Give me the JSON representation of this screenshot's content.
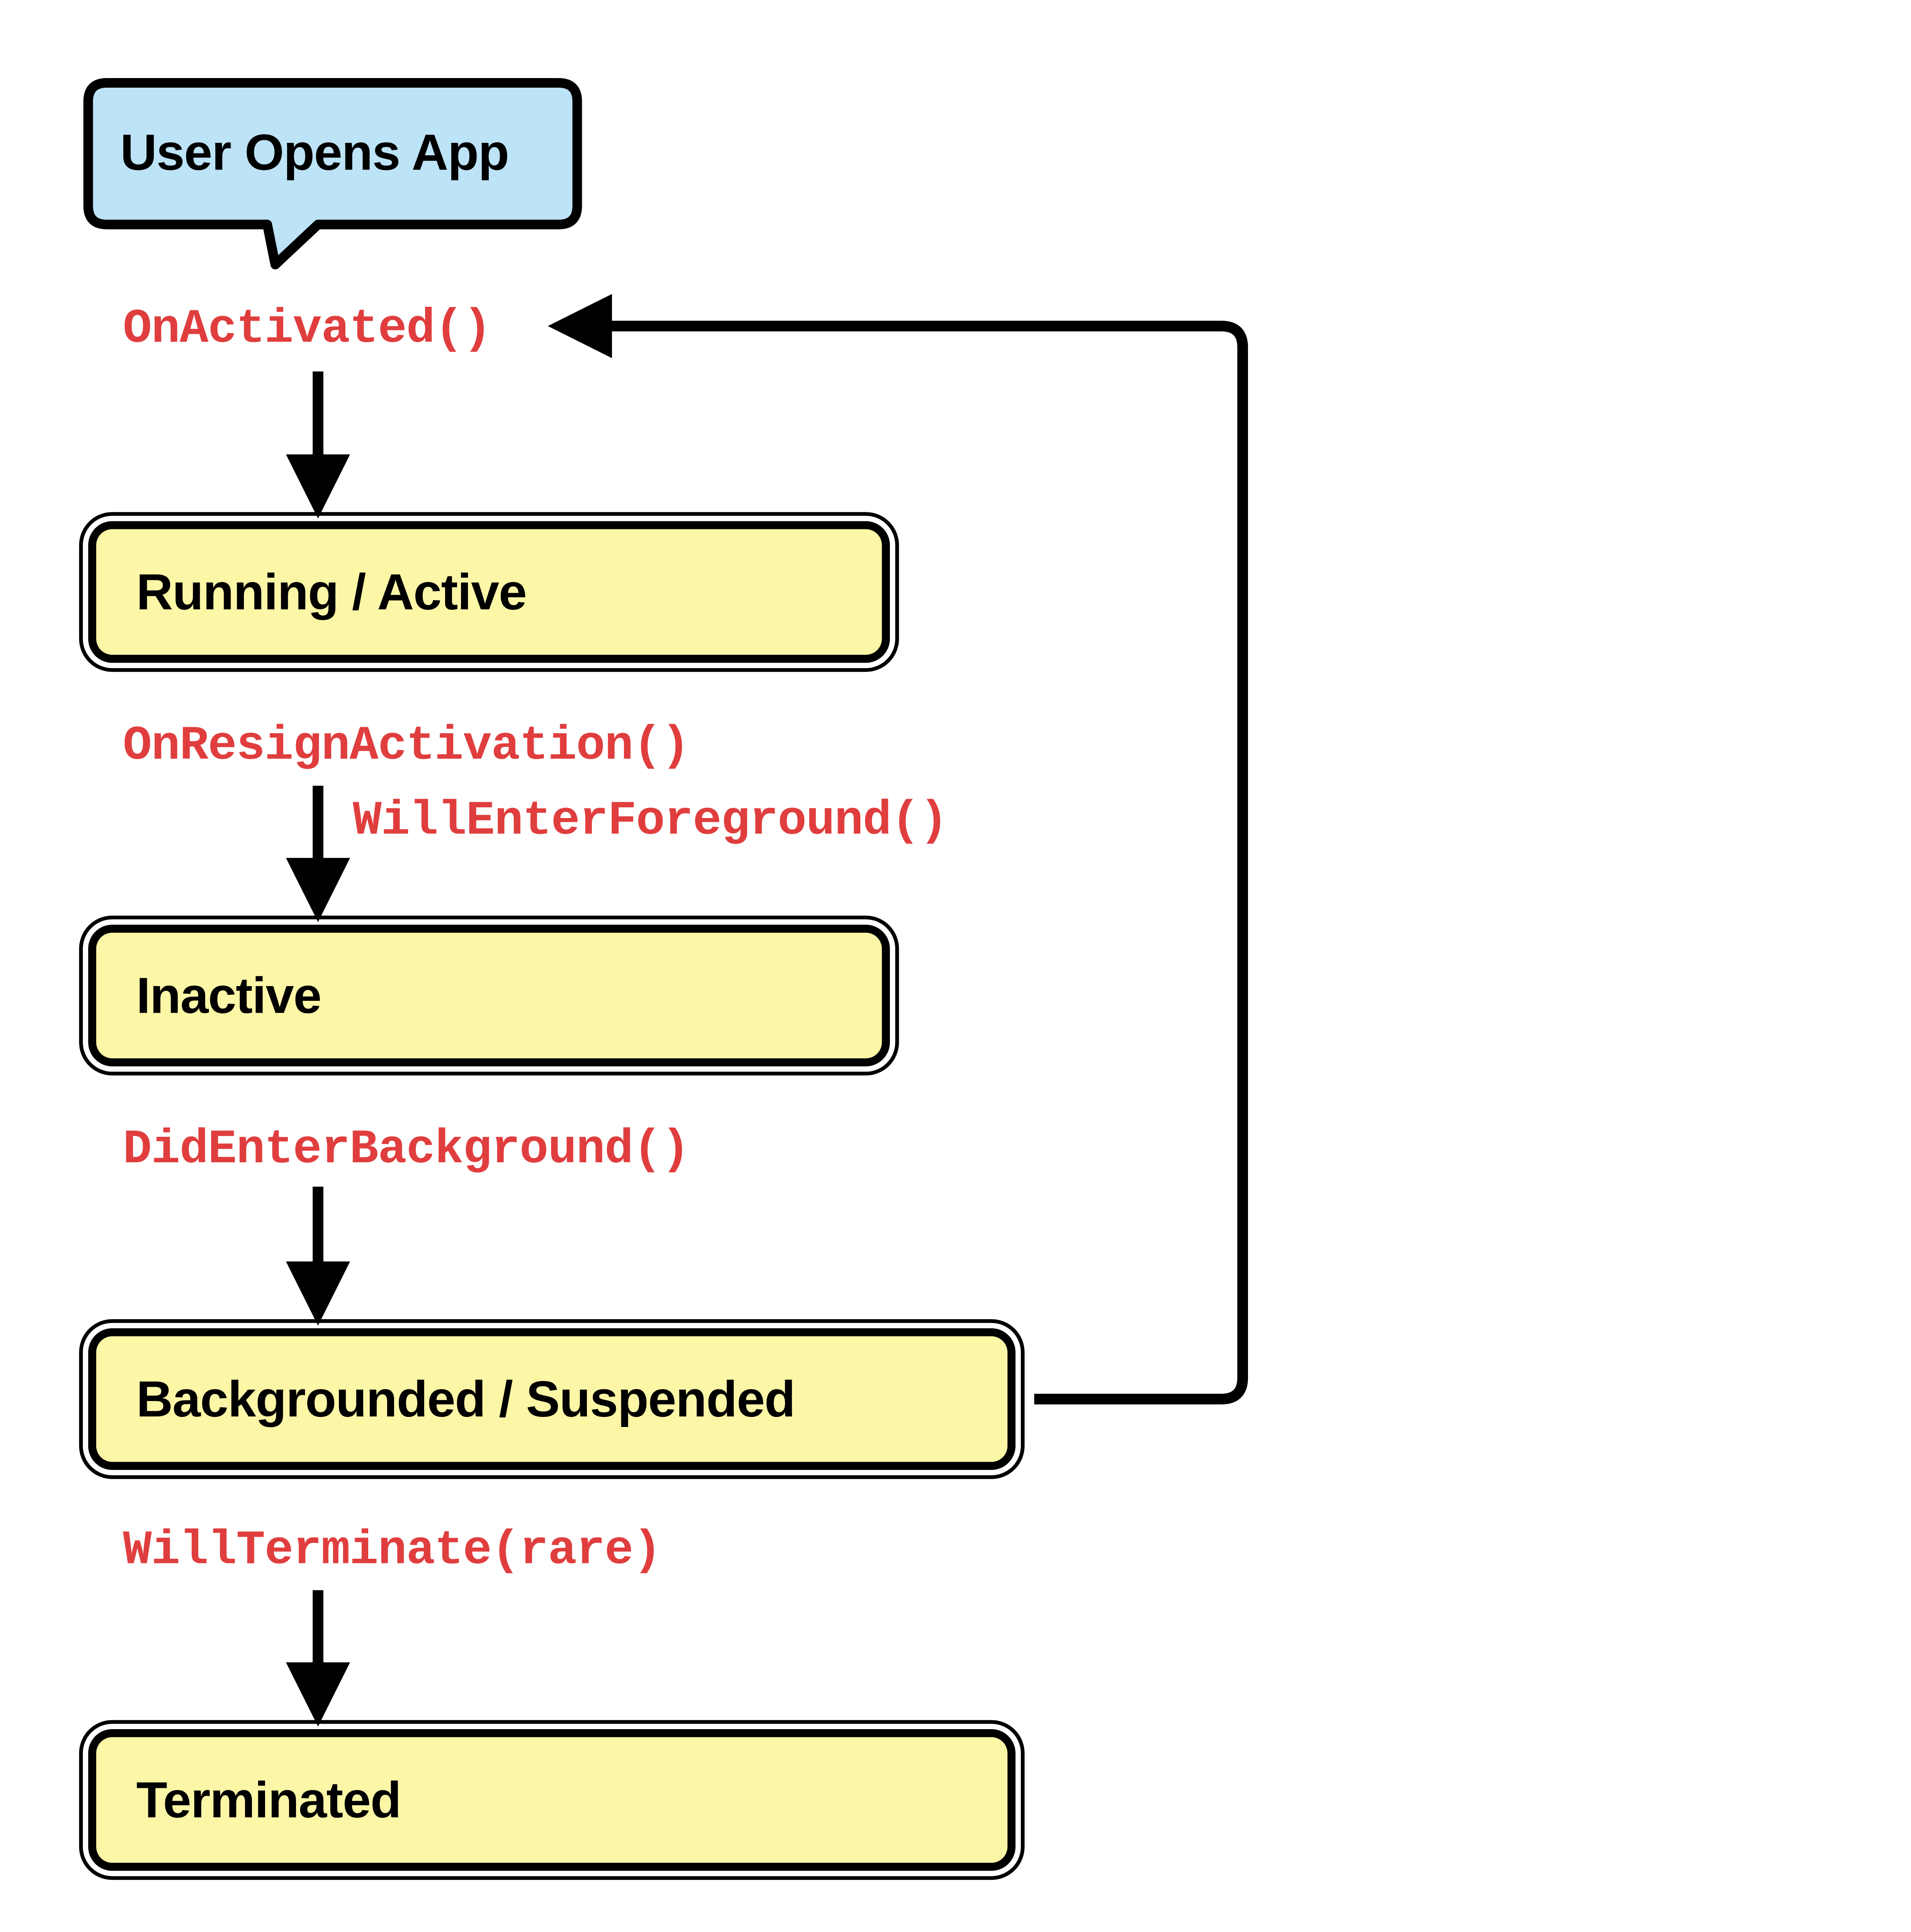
{
  "diagram": {
    "start": {
      "label": "User Opens App"
    },
    "states": {
      "running": {
        "label": "Running / Active"
      },
      "inactive": {
        "label": "Inactive"
      },
      "backgrounded": {
        "label": "Backgrounded / Suspended"
      },
      "terminated": {
        "label": "Terminated"
      }
    },
    "transitions": {
      "activated": {
        "label": "OnActivated()"
      },
      "resign_activation": {
        "label": "OnResignActivation()"
      },
      "will_enter_fg": {
        "label": "WillEnterForeground()"
      },
      "did_enter_bg": {
        "label": "DidEnterBackground()"
      },
      "will_terminate": {
        "label": "WillTerminate(rare)"
      }
    },
    "colors": {
      "start_fill": "#bde3f7",
      "state_fill": "#fcf6a7",
      "trans_text": "#e03e3e",
      "stroke": "#000000"
    }
  }
}
